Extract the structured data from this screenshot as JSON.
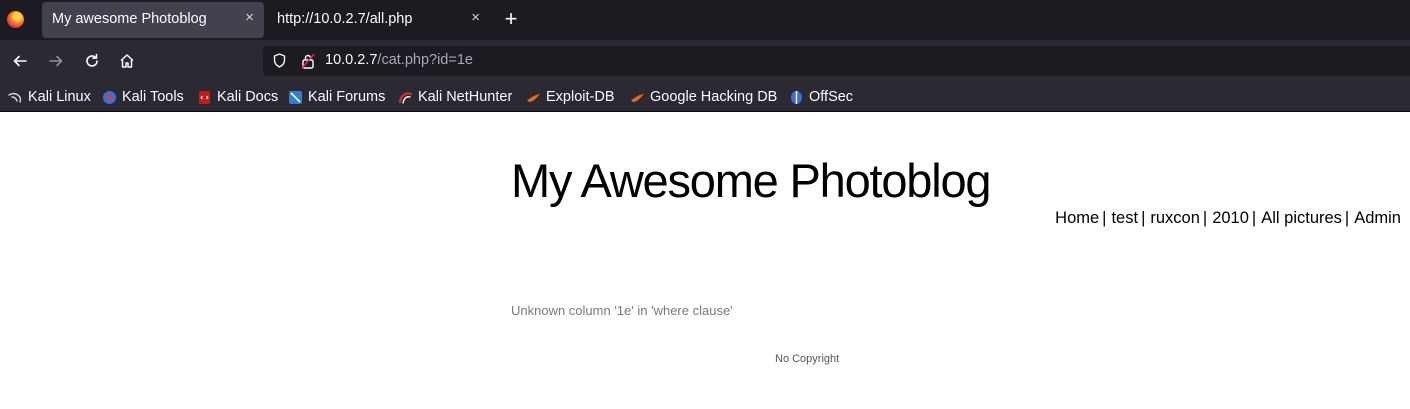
{
  "browser": {
    "tabs": [
      {
        "title": "My awesome Photoblog",
        "active": true
      },
      {
        "title": "http://10.0.2.7/all.php",
        "active": false
      }
    ],
    "close_glyph": "×",
    "new_tab_glyph": "+",
    "url": {
      "host": "10.0.2.7",
      "path": "/cat.php?id=1e"
    },
    "bookmarks": [
      {
        "label": "Kali Linux",
        "icon": "kali-dragon-icon",
        "color": "#1a1a1a"
      },
      {
        "label": "Kali Tools",
        "icon": "kali-tools-icon",
        "color": "#e23a3a"
      },
      {
        "label": "Kali Docs",
        "icon": "kali-docs-icon",
        "color": "#c81818"
      },
      {
        "label": "Kali Forums",
        "icon": "kali-forums-icon",
        "color": "#2f7fd8"
      },
      {
        "label": "Kali NetHunter",
        "icon": "kali-nethunter-icon",
        "color": "#d03030"
      },
      {
        "label": "Exploit-DB",
        "icon": "exploit-db-icon",
        "color": "#e8681a"
      },
      {
        "label": "Google Hacking DB",
        "icon": "google-hacking-db-icon",
        "color": "#e8681a"
      },
      {
        "label": "OffSec",
        "icon": "offsec-icon",
        "color": "#3a6fd8"
      }
    ]
  },
  "site": {
    "title": "My Awesome Photoblog",
    "nav": [
      {
        "label": "Home"
      },
      {
        "label": "test"
      },
      {
        "label": "ruxcon"
      },
      {
        "label": "2010"
      },
      {
        "label": "All pictures"
      },
      {
        "label": "Admin"
      }
    ],
    "nav_separator": "|",
    "error": "Unknown column '1e' in 'where clause'",
    "footer": "No Copyright"
  }
}
